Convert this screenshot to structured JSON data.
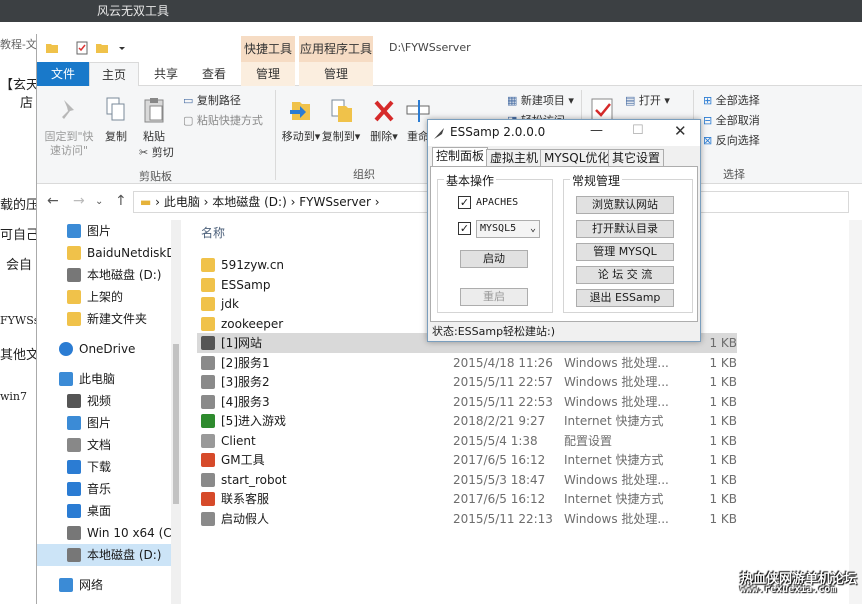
{
  "window_title": "风云无双工具",
  "background_doc": {
    "lines": [
      "教程-文",
      "【玄天",
      "店",
      "载的压",
      "可自己",
      "会自",
      "FYWSs",
      "其他文",
      "win7"
    ]
  },
  "explorer": {
    "context_tabs": [
      "快捷工具",
      "应用程序工具"
    ],
    "path_title": "D:\\FYWSserver",
    "tabs": {
      "file": "文件",
      "home": "主页",
      "share": "共享",
      "view": "查看",
      "manage1": "管理",
      "manage2": "管理"
    },
    "ribbon": {
      "pin_quick": "固定到\"快\n速访问\"",
      "copy": "复制",
      "paste": "粘贴",
      "copy_path": "复制路径",
      "paste_shortcut": "粘贴快捷方式",
      "cut": "剪切",
      "clipboard_group": "剪贴板",
      "move_to": "移动到",
      "copy_to": "复制到",
      "delete": "删除",
      "rename": "重命",
      "organize_group": "组织",
      "new_item": "新建项目",
      "easy_access": "轻松访问",
      "open": "打开",
      "select_all": "全部选择",
      "select_none": "全部取消",
      "invert_select": "反向选择",
      "select_group": "选择"
    },
    "address": {
      "parts": [
        "此电脑",
        "本地磁盘 (D:)",
        "FYWSserver"
      ]
    },
    "nav": [
      {
        "label": "图片",
        "icon": "pictures-icon"
      },
      {
        "label": "BaiduNetdiskD",
        "icon": "folder-icon"
      },
      {
        "label": "本地磁盘 (D:)",
        "icon": "drive-icon"
      },
      {
        "label": "上架的",
        "icon": "folder-icon"
      },
      {
        "label": "新建文件夹",
        "icon": "folder-icon"
      },
      {
        "label": "OneDrive",
        "icon": "onedrive-icon"
      },
      {
        "label": "此电脑",
        "icon": "computer-icon"
      },
      {
        "label": "视频",
        "icon": "video-icon"
      },
      {
        "label": "图片",
        "icon": "pictures-icon"
      },
      {
        "label": "文档",
        "icon": "documents-icon"
      },
      {
        "label": "下载",
        "icon": "download-icon"
      },
      {
        "label": "音乐",
        "icon": "music-icon"
      },
      {
        "label": "桌面",
        "icon": "desktop-icon"
      },
      {
        "label": "Win 10 x64 (C:)",
        "icon": "drive-icon"
      },
      {
        "label": "本地磁盘 (D:)",
        "icon": "drive-icon"
      },
      {
        "label": "网络",
        "icon": "network-icon"
      }
    ],
    "columns": {
      "name": "名称"
    },
    "files": [
      {
        "name": "591zyw.cn",
        "date": "",
        "type": "",
        "size": "",
        "icon": "folder-icon"
      },
      {
        "name": "ESSamp",
        "date": "",
        "type": "",
        "size": "",
        "icon": "folder-icon"
      },
      {
        "name": "jdk",
        "date": "",
        "type": "",
        "size": "",
        "icon": "folder-icon"
      },
      {
        "name": "zookeeper",
        "date": "",
        "type": "",
        "size": "",
        "icon": "folder-icon"
      },
      {
        "name": "[1]网站",
        "date": "",
        "type": "",
        "size": "1 KB",
        "icon": "shortcut-icon"
      },
      {
        "name": "[2]服务1",
        "date": "2015/4/18 11:26",
        "type": "Windows 批处理...",
        "size": "1 KB",
        "icon": "batch-icon"
      },
      {
        "name": "[3]服务2",
        "date": "2015/5/11 22:57",
        "type": "Windows 批处理...",
        "size": "1 KB",
        "icon": "batch-icon"
      },
      {
        "name": "[4]服务3",
        "date": "2015/5/11 22:53",
        "type": "Windows 批处理...",
        "size": "1 KB",
        "icon": "batch-icon"
      },
      {
        "name": "[5]进入游戏",
        "date": "2018/2/21 9:27",
        "type": "Internet 快捷方式",
        "size": "1 KB",
        "icon": "tree-icon"
      },
      {
        "name": "Client",
        "date": "2015/5/4 1:38",
        "type": "配置设置",
        "size": "1 KB",
        "icon": "config-icon"
      },
      {
        "name": "GM工具",
        "date": "2017/6/5 16:12",
        "type": "Internet 快捷方式",
        "size": "1 KB",
        "icon": "web-shortcut-icon"
      },
      {
        "name": "start_robot",
        "date": "2015/5/3 18:47",
        "type": "Windows 批处理...",
        "size": "1 KB",
        "icon": "batch-icon"
      },
      {
        "name": "联系客服",
        "date": "2017/6/5 16:12",
        "type": "Internet 快捷方式",
        "size": "1 KB",
        "icon": "web-shortcut-icon"
      },
      {
        "name": "启动假人",
        "date": "2015/5/11 22:13",
        "type": "Windows 批处理...",
        "size": "1 KB",
        "icon": "batch-icon"
      }
    ]
  },
  "dialog": {
    "title": "ESSamp 2.0.0.0",
    "tabs": [
      "控制面板",
      "虚拟主机",
      "MYSQL优化",
      "其它设置"
    ],
    "basic_group": "基本操作",
    "apache_label": "APACHES",
    "mysql_select": "MYSQL5",
    "start_button": "启动",
    "restart_button": "重启",
    "general_group": "常规管理",
    "buttons": [
      "浏览默认网站",
      "打开默认目录",
      "管理  MYSQL",
      "论 坛 交 流",
      "退出  ESSamp"
    ],
    "status": "状态:ESSamp轻松建站:)"
  },
  "watermark": {
    "line1": "热血侠网游单机论坛",
    "line2": "www.rexuexia.com"
  },
  "colors": {
    "file_tab": "#1979ca",
    "context_tab": "#f6dcc4",
    "selected_nav": "#cce4f7"
  }
}
